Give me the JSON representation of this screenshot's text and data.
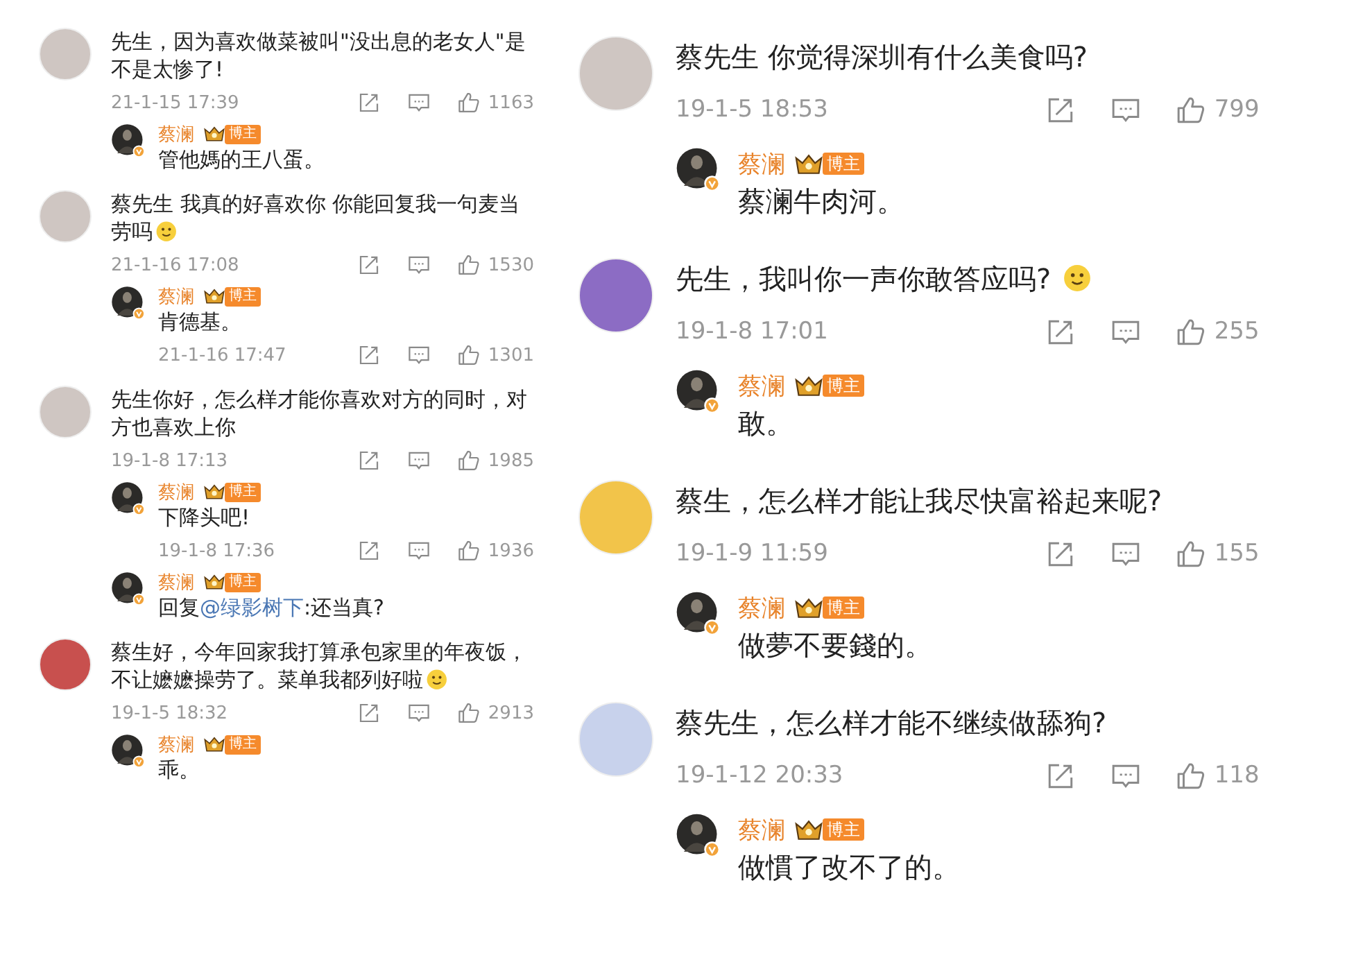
{
  "panels": [
    {
      "threads": [
        {
          "text": "先生，因为喜欢做菜被叫\"没出息的老女人\"是不是太惨了!",
          "emoji": false,
          "time": "21-1-15 17:39",
          "likes": "1163",
          "replies": [
            {
              "name": "蔡澜",
              "badge": "博主",
              "text": "管他媽的王八蛋。"
            }
          ]
        },
        {
          "text": "蔡先生 我真的好喜欢你 你能回复我一句麦当劳吗",
          "emoji": true,
          "time": "21-1-16 17:08",
          "likes": "1530",
          "replies": [
            {
              "name": "蔡澜",
              "badge": "博主",
              "text": "肯德基。",
              "time": "21-1-16 17:47",
              "likes": "1301"
            }
          ]
        },
        {
          "text": "先生你好，怎么样才能你喜欢对方的同时，对方也喜欢上你",
          "emoji": false,
          "time": "19-1-8 17:13",
          "likes": "1985",
          "replies": [
            {
              "name": "蔡澜",
              "badge": "博主",
              "text": "下降头吧!",
              "time": "19-1-8 17:36",
              "likes": "1936"
            },
            {
              "name": "蔡澜",
              "badge": "博主",
              "prefix": "回复",
              "mention": "@绿影树下",
              "text": ":还当真?"
            }
          ]
        },
        {
          "text": "蔡生好，今年回家我打算承包家里的年夜饭，不让嬷嬷操劳了。菜单我都列好啦",
          "emoji": true,
          "time": "19-1-5 18:32",
          "likes": "2913",
          "replies": [
            {
              "name": "蔡澜",
              "badge": "博主",
              "text": "乖。"
            }
          ]
        }
      ]
    },
    {
      "threads": [
        {
          "text": "蔡先生 你觉得深圳有什么美食吗?",
          "emoji": false,
          "time": "19-1-5 18:53",
          "likes": "799",
          "replies": [
            {
              "name": "蔡澜",
              "badge": "博主",
              "text": "蔡澜牛肉河。"
            }
          ]
        },
        {
          "text": "先生，我叫你一声你敢答应吗? ",
          "emoji": true,
          "time": "19-1-8 17:01",
          "likes": "255",
          "replies": [
            {
              "name": "蔡澜",
              "badge": "博主",
              "text": "敢。"
            }
          ]
        },
        {
          "text": "蔡生，怎么样才能让我尽快富裕起来呢?",
          "emoji": false,
          "time": "19-1-9 11:59",
          "likes": "155",
          "replies": [
            {
              "name": "蔡澜",
              "badge": "博主",
              "text": "做夢不要錢的。"
            }
          ]
        },
        {
          "text": "蔡先生，怎么样才能不继续做舔狗?",
          "emoji": false,
          "time": "19-1-12 20:33",
          "likes": "118",
          "replies": [
            {
              "name": "蔡澜",
              "badge": "博主",
              "text": "做慣了改不了的。"
            }
          ]
        }
      ]
    }
  ]
}
